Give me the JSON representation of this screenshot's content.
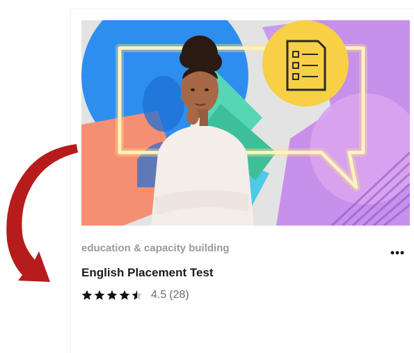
{
  "card": {
    "category": "education & capacity building",
    "title": "English Placement Test",
    "rating": {
      "stars": 4.5,
      "max": 5,
      "value_text": "4.5",
      "count_text": "(28)"
    },
    "more_icon": "more-horizontal-icon",
    "thumbnail_icon": "checklist-document-icon"
  },
  "annotation": {
    "arrow_icon": "curved-arrow-icon",
    "arrow_color": "#b71c1c"
  },
  "colors": {
    "title": "#1c1c1c",
    "category": "#9a9a9a",
    "rating_text": "#6a6a6a",
    "badge": "#f7d046"
  }
}
